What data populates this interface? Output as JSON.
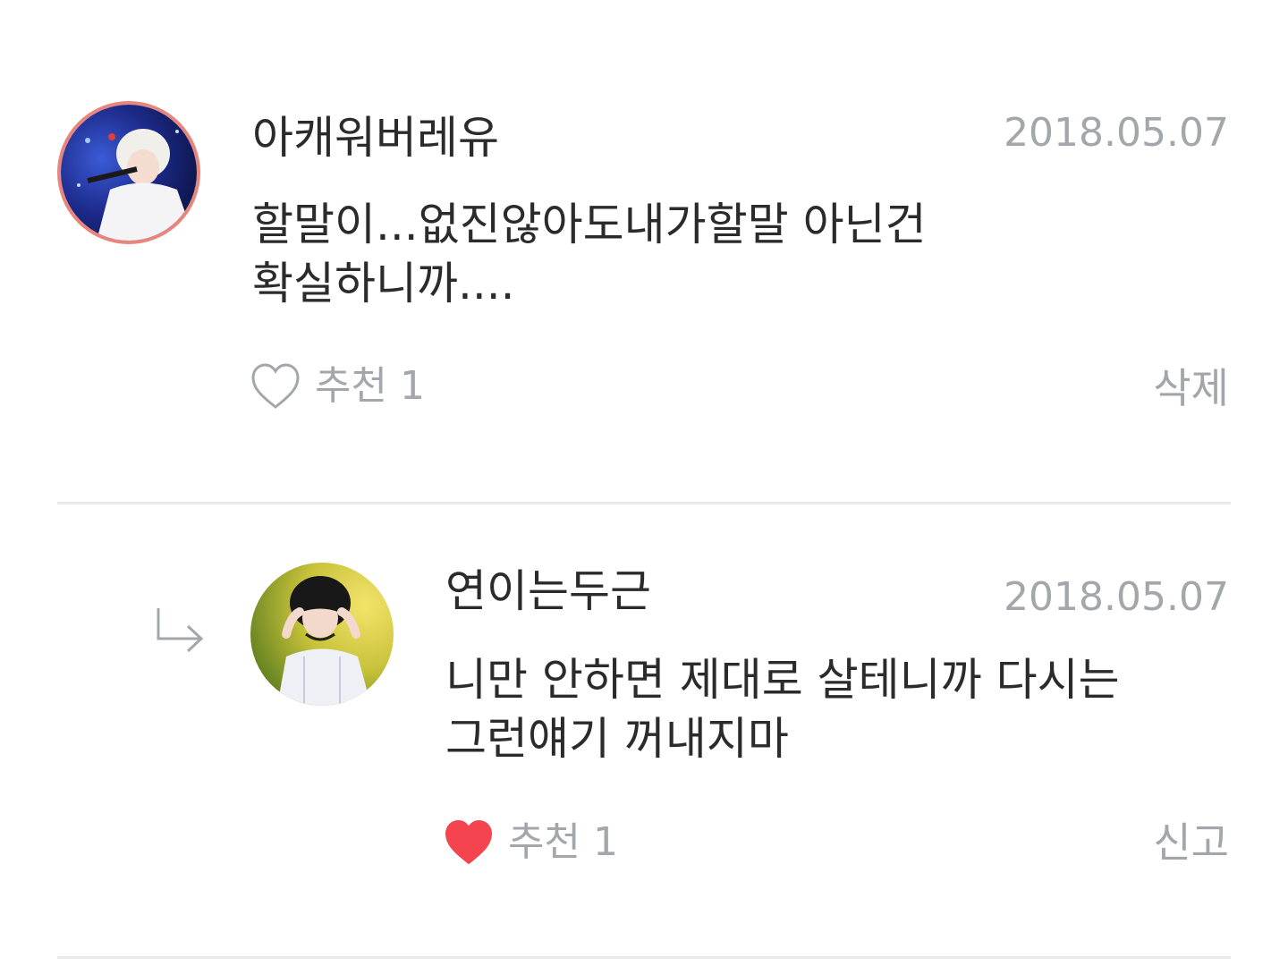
{
  "comments": [
    {
      "author": "아캐워버레유",
      "date": "2018.05.07",
      "text": "할말이...없진않아도내가할말 아닌건\n확실하니까....",
      "like_label": "추천",
      "like_count": "1",
      "liked": false,
      "action": "삭제",
      "is_reply": false
    },
    {
      "author": "연이는두근",
      "date": "2018.05.07",
      "text": "니만 안하면 제대로 살테니까 다시는\n그런얘기 꺼내지마",
      "like_label": "추천",
      "like_count": "1",
      "liked": true,
      "action": "신고",
      "is_reply": true
    }
  ],
  "colors": {
    "text": "#2b2b2b",
    "muted": "#a3a7ac",
    "heart_active": "#f4444f",
    "heart_outline": "#a3a7ac",
    "divider": "#e9eaec",
    "avatar_ring": "#e8857c"
  },
  "icons": {
    "reply": "reply-arrow-icon",
    "like_empty": "heart-outline-icon",
    "like_filled": "heart-filled-icon"
  }
}
